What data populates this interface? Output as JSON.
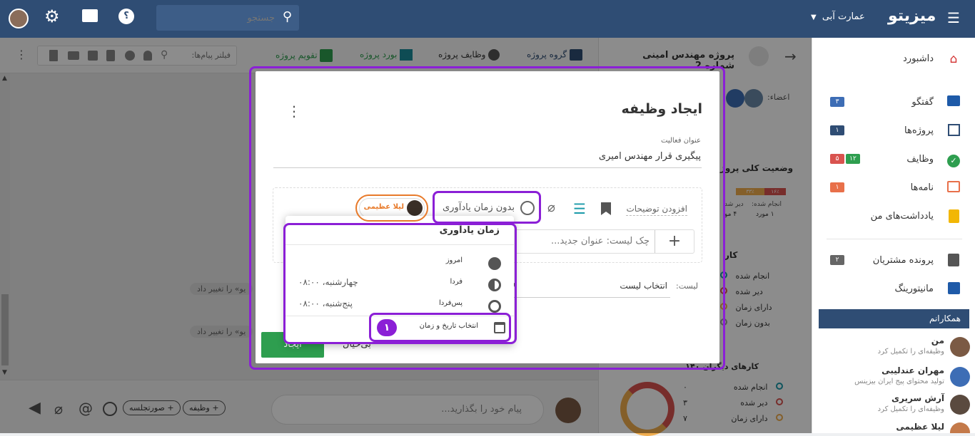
{
  "topbar": {
    "brand": "میزیتو",
    "org": "عمارت آبی",
    "search_placeholder": "جستجو"
  },
  "sidebar": {
    "items": [
      {
        "label": "داشبورد",
        "icon": "home-icon",
        "color": "#d32f2f",
        "badge": ""
      },
      {
        "label": "گفتگو",
        "icon": "chat-icon",
        "color": "#1e5aa8",
        "badge": "۳",
        "badge_color": "#3d6db5"
      },
      {
        "label": "پروژه‌ها",
        "icon": "projects-icon",
        "color": "#2f4d74",
        "badge": "۱",
        "badge_color": "#2f4d74"
      },
      {
        "label": "وظایف",
        "icon": "task-check-icon",
        "color": "#2e9e4f",
        "badge": "۱۲",
        "badge_color": "#2e9e4f",
        "badge2": "۵",
        "badge2_color": "#d9534f"
      },
      {
        "label": "نامه‌ها",
        "icon": "mail-icon",
        "color": "#e8704a",
        "badge": "۱",
        "badge_color": "#e8704a"
      },
      {
        "label": "یادداشت‌های من",
        "icon": "notes-icon",
        "color": "#f2b705",
        "badge": ""
      },
      {
        "label": "پرونده مشتریان",
        "icon": "customer-file-icon",
        "color": "#555",
        "badge": "۲",
        "badge_color": "#666"
      },
      {
        "label": "مانیتورینگ",
        "icon": "monitoring-icon",
        "color": "#1e5aa8",
        "badge": ""
      }
    ],
    "colleagues_header": "همکارانم",
    "colleagues": [
      {
        "name": "من",
        "status": "وظیفه‌ای را تکمیل کرد"
      },
      {
        "name": "مهران عندلیبی",
        "status": "تولید محتوای پیج ایران بیزینس"
      },
      {
        "name": "آرش سریری",
        "status": "وظیفه‌ای را تکمیل کرد"
      },
      {
        "name": "لیلا عظیمی",
        "status": ""
      }
    ]
  },
  "center": {
    "tabs": [
      "گروه پروژه",
      "وظایف پروژه",
      "بورد پروژه",
      "تقویم پروژه"
    ],
    "filter_placeholder": "فیلتر پیام‌ها:",
    "log1": "یو» را تغییر داد",
    "log2": "یو» را تغییر داد",
    "message_placeholder": "پیام خود را بگذارید...",
    "chip_meeting": "+ صورتجلسه",
    "chip_task": "+ وظیفه"
  },
  "project": {
    "title": "پروژه مهندس امینی شماره 2",
    "members_label": "اعضاء:",
    "status_label": "وضعیت کلی پروژ",
    "bar_pcts": [
      "۳۳٪",
      "۱۶٪"
    ],
    "done_label": "انجام شده:",
    "late_label": "دیر شد",
    "done_count": "۱ مورد",
    "late_count": "۴ مو",
    "kar_label": "کار",
    "legend": [
      "انجام شده",
      "دیر شده",
      "دارای زمان",
      "بدون زمان"
    ],
    "others_label": "کارهای دیگران ۱۴۰",
    "others_legend": [
      {
        "label": "انجام شده",
        "value": "۰"
      },
      {
        "label": "دیر شده",
        "value": "۳"
      },
      {
        "label": "دارای زمان",
        "value": "۷"
      }
    ]
  },
  "modal": {
    "title": "ایجاد وظیفه",
    "field_label": "عنوان فعالیت",
    "field_value": "پیگیری قرار مهندس امیری",
    "add_desc": "افزودن توضیحات",
    "reminder": "بدون زمان یادآوری",
    "assignee": "لیلا عظیمی",
    "checklist_placeholder": "چک لیست: عنوان جدید...",
    "list_label": "لیست:",
    "list_value": "انتخاب لیست",
    "create_btn": "ایجاد",
    "cancel_btn": "بی‌خیال"
  },
  "reminder_popup": {
    "title": "زمان یادآوری",
    "options": [
      {
        "label": "امروز",
        "time": "",
        "icon": "sun-icon"
      },
      {
        "label": "فردا",
        "time": "چهارشنبه، ۰۸:۰۰",
        "icon": "half-sun-icon"
      },
      {
        "label": "پس‌فردا",
        "time": "پنج‌شنبه، ۰۸:۰۰",
        "icon": "sun-outline-icon"
      }
    ],
    "pick": "انتخاب تاریخ و زمان",
    "step_number": "۱"
  }
}
